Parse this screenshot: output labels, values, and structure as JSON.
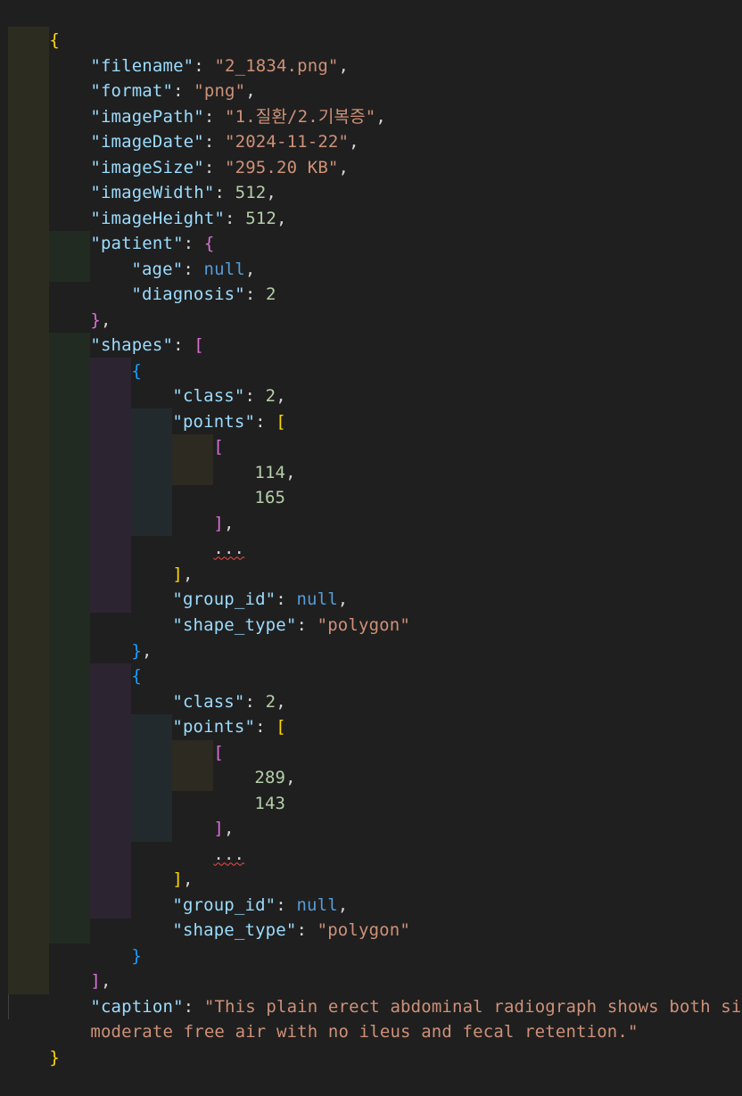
{
  "document": {
    "open_brace": "{",
    "close_brace": "}",
    "lines": {
      "filename": {
        "key": "\"filename\"",
        "value": "\"2_1834.png\""
      },
      "format": {
        "key": "\"format\"",
        "value": "\"png\""
      },
      "imagePath": {
        "key": "\"imagePath\"",
        "value": "\"1.질환/2.기복증\""
      },
      "imageDate": {
        "key": "\"imageDate\"",
        "value": "\"2024-11-22\""
      },
      "imageSize": {
        "key": "\"imageSize\"",
        "value": "\"295.20 KB\""
      },
      "imageWidth": {
        "key": "\"imageWidth\"",
        "value": "512"
      },
      "imageHeight": {
        "key": "\"imageHeight\"",
        "value": "512"
      },
      "patient": {
        "key": "\"patient\""
      },
      "age": {
        "key": "\"age\"",
        "value": "null"
      },
      "diagnosis": {
        "key": "\"diagnosis\"",
        "value": "2"
      },
      "shapes": {
        "key": "\"shapes\""
      },
      "caption": {
        "key": "\"caption\"",
        "value_line1": "\"This plain erect abdominal radiograph shows both sides",
        "value_line2": "moderate free air with no ileus and fecal retention.\""
      }
    },
    "shapes": [
      {
        "class_key": "\"class\"",
        "class_value": "2",
        "points_key": "\"points\"",
        "point_x": "114",
        "point_y": "165",
        "ellipsis": "...",
        "group_id_key": "\"group_id\"",
        "group_id_value": "null",
        "shape_type_key": "\"shape_type\"",
        "shape_type_value": "\"polygon\""
      },
      {
        "class_key": "\"class\"",
        "class_value": "2",
        "points_key": "\"points\"",
        "point_x": "289",
        "point_y": "143",
        "ellipsis": "...",
        "group_id_key": "\"group_id\"",
        "group_id_value": "null",
        "shape_type_key": "\"shape_type\"",
        "shape_type_value": "\"polygon\""
      }
    ]
  },
  "colors": {
    "background": "#1f1f1f",
    "key": "#9cdcfe",
    "string": "#ce9178",
    "number": "#b5cea8",
    "keyword": "#569cd6",
    "bracket_level1": "#ffd700",
    "bracket_level2": "#da70d6",
    "bracket_level3": "#179fff",
    "indent_level1": "#2c2c21",
    "indent_level2": "#222b22",
    "indent_level3": "#2d2431",
    "indent_level4": "#222a2e",
    "indent_level5": "#2c2a21"
  }
}
